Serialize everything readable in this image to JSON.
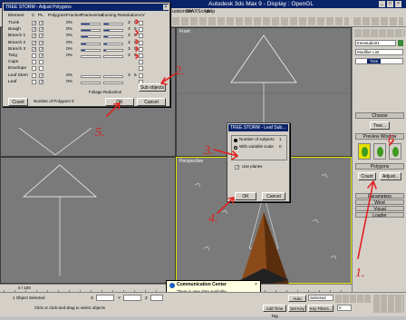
{
  "app": {
    "title": "Autodesk 3ds Max 9 - Display : OpenGL",
    "menus": [
      "Customize",
      "MAXScript",
      "Help"
    ]
  },
  "viewports": {
    "top_left": "",
    "top_right": "Front",
    "bottom_left": "",
    "bottom_right": "Perspective"
  },
  "command_panel": {
    "object_name": "treestudio01",
    "modifier_list": "Modifier List",
    "tree_label": "Tree",
    "choose_label": "Choose",
    "tree_button": "Tree...",
    "preview_label": "Preview Window",
    "polygons_label": "Polygons",
    "count_button": "Count",
    "adjust_button": "Adjust...",
    "parameters_label": "Parameters",
    "wind_label": "Wind",
    "visual_label": "Visual",
    "loader_label": "Loader"
  },
  "adjust_dialog": {
    "title": "TREE STORM - Adjust Polygons",
    "headers": {
      "element": "Element",
      "c": "C",
      "pl": "PL",
      "polygons": "Polygons",
      "fraction": "Fraction",
      "transversal": "Transversal",
      "curving": "Curving Resolution",
      "uv": "UV"
    },
    "rows": [
      {
        "name": "Trunk",
        "c": true,
        "pl": true,
        "pct": "0%",
        "fill": 0.45,
        "a": "3",
        "b": "5",
        "mark": true
      },
      {
        "name": "Bough",
        "c": true,
        "pl": true,
        "pct": "0%",
        "fill": 0.5,
        "a": "3",
        "b": "5",
        "mark": true
      },
      {
        "name": "Branch 1",
        "c": true,
        "pl": true,
        "pct": "0%",
        "fill": 0.35,
        "a": "3",
        "b": "5",
        "mark": true
      },
      {
        "name": "Branch 2",
        "c": true,
        "pl": true,
        "pct": "0%",
        "fill": 0.25,
        "a": "3",
        "b": "5",
        "mark": true
      },
      {
        "name": "Branch 3",
        "c": true,
        "pl": true,
        "pct": "0%",
        "fill": 0.2,
        "a": "3",
        "b": "5",
        "mark": true
      },
      {
        "name": "Twig",
        "c": false,
        "pl": true,
        "pct": "0%",
        "fill": 0.0,
        "a": "3",
        "b": "5",
        "mark": false
      },
      {
        "name": "Caps",
        "c": false,
        "pl": false,
        "pct": "",
        "fill": 0,
        "a": "",
        "b": "",
        "mark": false
      },
      {
        "name": "Envelope",
        "c": false,
        "pl": false,
        "pct": "",
        "fill": 0,
        "a": "",
        "b": "",
        "mark": false
      },
      {
        "name": "Leaf Stem",
        "c": false,
        "pl": true,
        "pct": "0%",
        "fill": 0,
        "a": "3",
        "b": "5",
        "mark": false
      },
      {
        "name": "Leaf",
        "c": false,
        "pl": true,
        "pct": "0%",
        "fill": 0,
        "a": "",
        "b": "",
        "mark": false
      }
    ],
    "foliage": "Foliage Reduction",
    "subobjects": "Sub objects",
    "count": "Count",
    "num_polygons": "Number of Polygons",
    "num_value": "0",
    "ok": "OK",
    "cancel": "Cancel"
  },
  "leaf_dialog": {
    "title": "TREE STORM - Leaf Sub...",
    "num_label": "Number of subjects",
    "num_value": "1",
    "var_label": "With variable scale",
    "var_value": "0",
    "use_planes": "Use planes",
    "ok": "OK",
    "cancel": "Cancel"
  },
  "annotations": [
    "1.",
    "2.",
    "3.",
    "4.",
    "5.",
    "6"
  ],
  "comm": {
    "title": "Communication Center",
    "text": "There is new data available.",
    "click": "Click here to view."
  },
  "timeline": {
    "frame": "0 / 100"
  },
  "status": {
    "selected": "1 Object Selected",
    "prompt": "Click or click-and-drag to select objects",
    "add_tag": "Add Time Tag",
    "auto_key": "Auto Key",
    "selected_drop": "Selected",
    "set_key": "Set Key",
    "key_filters": "Key Filters...",
    "x_label": "X",
    "y_label": "Y",
    "z_label": "Z",
    "frame_num": "0"
  }
}
